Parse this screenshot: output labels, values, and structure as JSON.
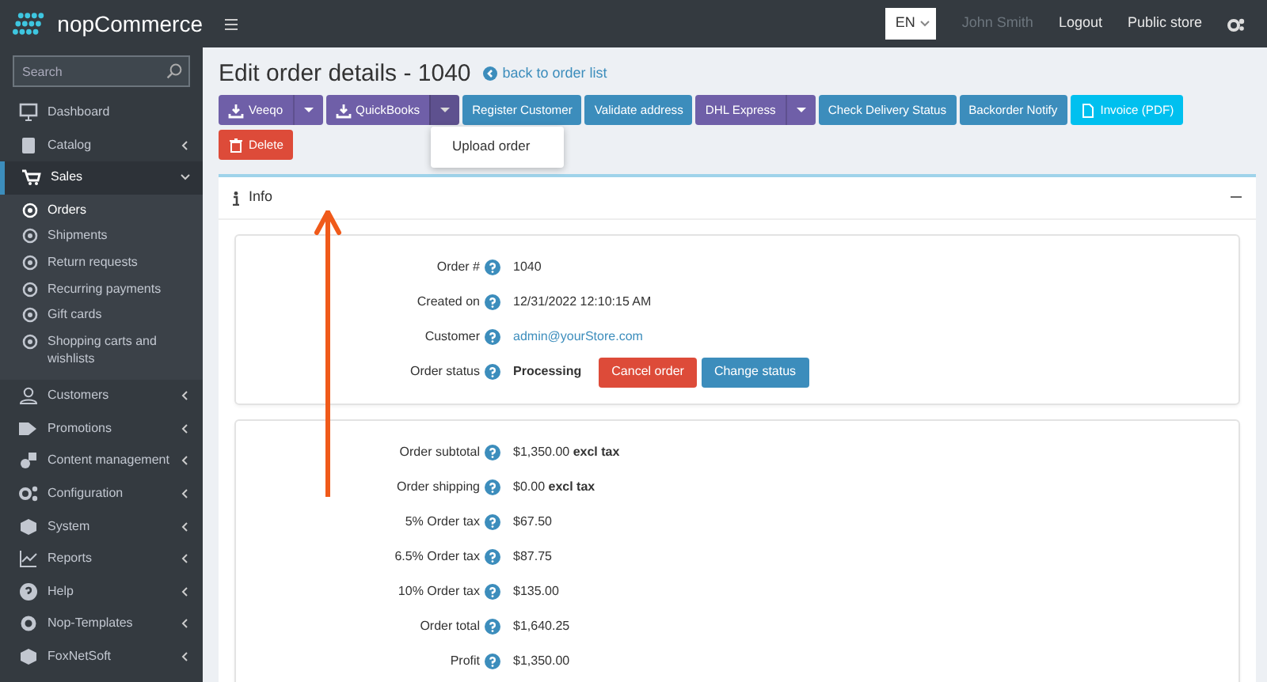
{
  "topbar": {
    "brand": "nopCommerce",
    "language": "EN",
    "user": "John Smith",
    "links": [
      "Logout",
      "Public store"
    ]
  },
  "sidebar": {
    "search": {
      "placeholder": "Search"
    },
    "items": [
      {
        "label": "Dashboard",
        "has_children": false,
        "expanded": false
      },
      {
        "label": "Catalog",
        "has_children": true,
        "expanded": false
      },
      {
        "label": "Sales",
        "has_children": true,
        "expanded": true,
        "children": [
          {
            "label": "Orders",
            "selected": true
          },
          {
            "label": "Shipments",
            "selected": false
          },
          {
            "label": "Return requests",
            "selected": false
          },
          {
            "label": "Recurring payments",
            "selected": false
          },
          {
            "label": "Gift cards",
            "selected": false
          },
          {
            "label": "Shopping carts and wishlists",
            "selected": false
          }
        ]
      },
      {
        "label": "Customers",
        "has_children": true,
        "expanded": false
      },
      {
        "label": "Promotions",
        "has_children": true,
        "expanded": false
      },
      {
        "label": "Content management",
        "has_children": true,
        "expanded": false
      },
      {
        "label": "Configuration",
        "has_children": true,
        "expanded": false
      },
      {
        "label": "System",
        "has_children": true,
        "expanded": false
      },
      {
        "label": "Reports",
        "has_children": true,
        "expanded": false
      },
      {
        "label": "Help",
        "has_children": true,
        "expanded": false
      },
      {
        "label": "Nop-Templates",
        "has_children": true,
        "expanded": false
      },
      {
        "label": "FoxNetSoft",
        "has_children": true,
        "expanded": false
      }
    ]
  },
  "page": {
    "title": "Edit order details - 1040",
    "back_link": "back to order list",
    "button_rows": [
      [
        {
          "label": "Veeqo",
          "kind": "export",
          "menu_open": false
        },
        {
          "label": "QuickBooks",
          "kind": "export",
          "menu_open": true,
          "menu": [
            "Upload order"
          ]
        },
        {
          "label": "Register Customer",
          "kind": "action"
        },
        {
          "label": "Validate address",
          "kind": "action"
        },
        {
          "label": "DHL Express",
          "kind": "split",
          "menu_open": false
        },
        {
          "label": "Check Delivery Status",
          "kind": "action"
        },
        {
          "label": "Backorder Notify",
          "kind": "action"
        },
        {
          "label": "Invoice (PDF)",
          "kind": "pdf"
        }
      ],
      [
        {
          "label": "Delete",
          "kind": "delete"
        }
      ]
    ],
    "panel": {
      "title": "Info",
      "collapsed": false,
      "sections": [
        [
          {
            "label": "Order #",
            "kind": "text",
            "value": "1040"
          },
          {
            "label": "Created on",
            "kind": "text",
            "value": "12/31/2022 12:10:15 AM"
          },
          {
            "label": "Customer",
            "kind": "link",
            "value": "admin@yourStore.com"
          },
          {
            "label": "Order status",
            "kind": "status",
            "value": "Processing",
            "actions": [
              {
                "label": "Cancel order",
                "kind": "delete"
              },
              {
                "label": "Change status",
                "kind": "action"
              }
            ]
          }
        ],
        [
          {
            "label": "Order subtotal",
            "kind": "text",
            "value": "$1,350.00 **excl tax**"
          },
          {
            "label": "Order shipping",
            "kind": "text",
            "value": "$0.00 **excl tax**"
          },
          {
            "label": "5% Order tax",
            "kind": "text",
            "value": "$67.50"
          },
          {
            "label": "6.5% Order tax",
            "kind": "text",
            "value": "$87.75"
          },
          {
            "label": "10% Order tax",
            "kind": "text",
            "value": "$135.00"
          },
          {
            "label": "Order total",
            "kind": "text",
            "value": "$1,640.25"
          },
          {
            "label": "Profit",
            "kind": "text",
            "value": "$1,350.00"
          }
        ]
      ]
    }
  }
}
